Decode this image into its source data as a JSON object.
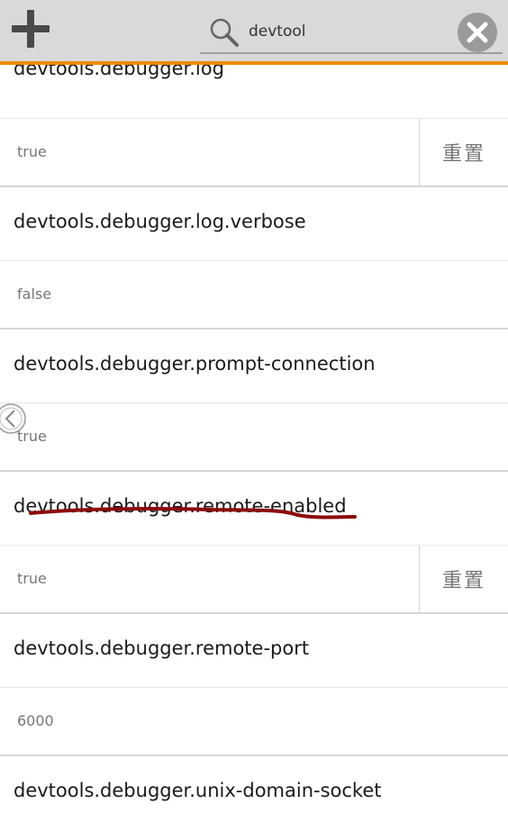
{
  "toolbar": {
    "add_icon": "plus-icon",
    "search": {
      "value": "devtool",
      "icon": "search-icon"
    },
    "clear_icon": "close-circle-icon",
    "accent_color": "#f08a00"
  },
  "prefs": [
    {
      "name": "devtools.debugger.log",
      "value": "true",
      "reset_label": "重置"
    },
    {
      "name": "devtools.debugger.log.verbose",
      "value": "false"
    },
    {
      "name": "devtools.debugger.prompt-connection",
      "value": "true"
    },
    {
      "name": "devtools.debugger.remote-enabled",
      "value": "true",
      "reset_label": "重置"
    },
    {
      "name": "devtools.debugger.remote-port",
      "value": "6000"
    },
    {
      "name": "devtools.debugger.unix-domain-socket"
    }
  ],
  "annotation": {
    "underline_color": "#8b0a0a"
  }
}
